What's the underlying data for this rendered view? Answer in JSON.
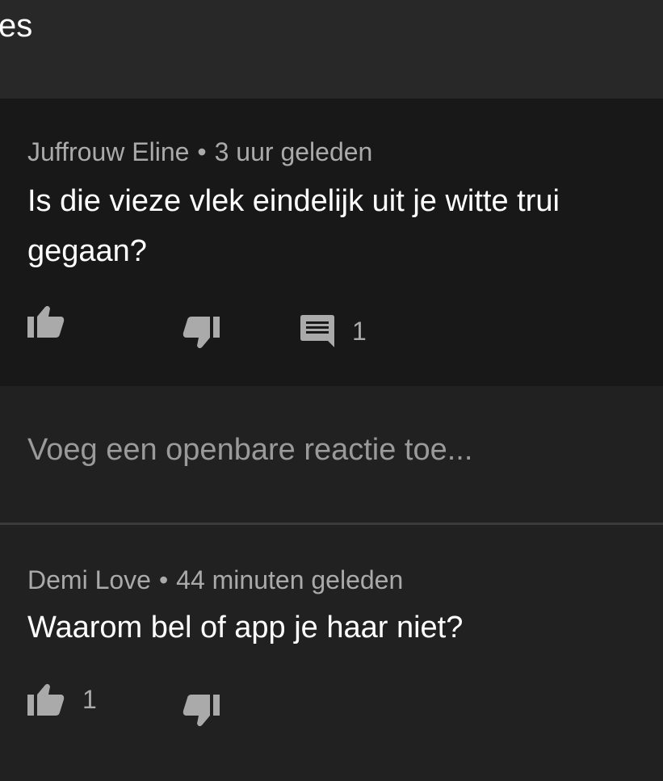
{
  "header": {
    "title": "es"
  },
  "comments": [
    {
      "author": "Juffrouw Eline",
      "separator": "•",
      "time": "3 uur geleden",
      "text": "Is die vieze vlek eindelijk uit je witte trui gegaan?",
      "reply_count": "1"
    },
    {
      "author": "Demi Love",
      "separator": "•",
      "time": "44 minuten geleden",
      "text": "Waarom bel of app je haar niet?",
      "like_count": "1"
    }
  ],
  "add_reply": {
    "placeholder": "Voeg een openbare reactie toe..."
  },
  "icons": {
    "like": "thumbs-up-icon",
    "dislike": "thumbs-down-icon",
    "reply": "comment-icon"
  },
  "colors": {
    "background": "#212121",
    "highlight": "#181818",
    "header": "#282828",
    "secondary_text": "#aaaaaa"
  }
}
